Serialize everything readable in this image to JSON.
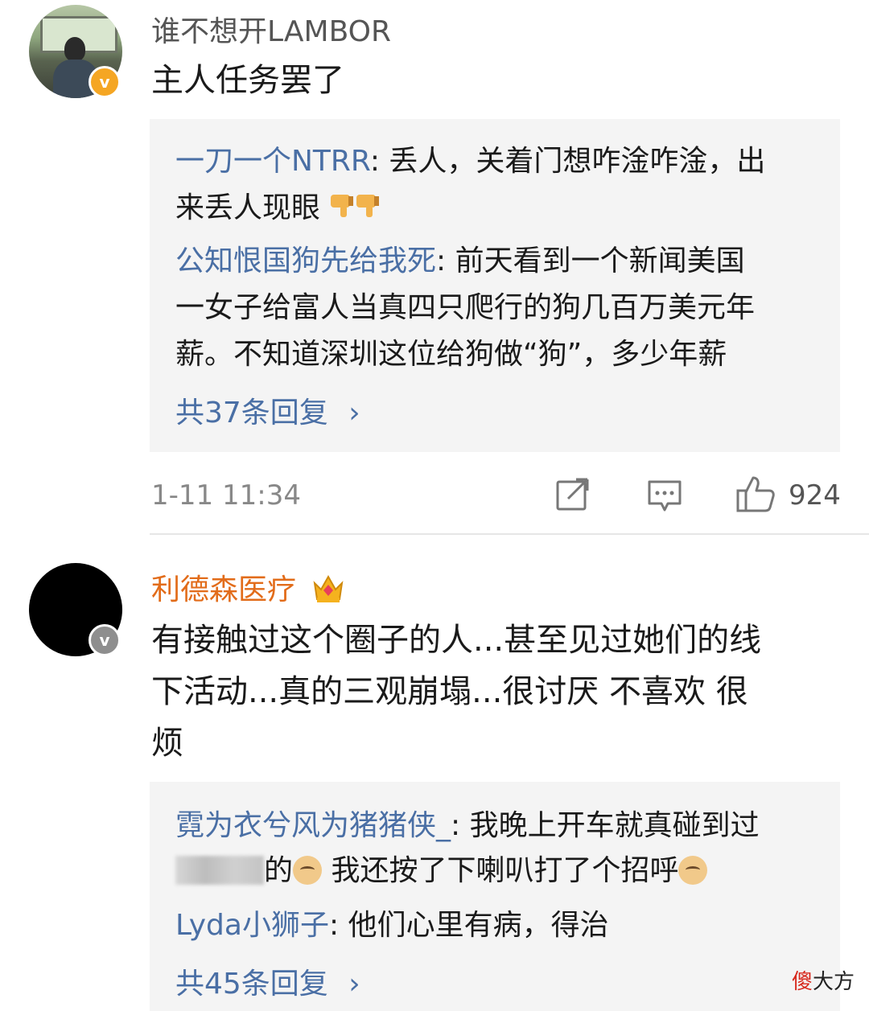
{
  "comment1": {
    "username": "谁不想开LAMBOR",
    "text": "主人任务罢了",
    "badge": "v",
    "replies": [
      {
        "name": "一刀一个NTRR",
        "sep": ": ",
        "text_line1": "丢人，关着门想咋淦咋淦，出",
        "text_line2": "来丢人现眼",
        "emoji": "thumbs-down-icon"
      },
      {
        "name": "公知恨国狗先给我死",
        "sep": ": ",
        "text_line1": "前天看到一个新闻美国",
        "text_line2": "一女子给富人当真四只爬行的狗几百万美元年",
        "text_line3": "薪。不知道深圳这位给狗做“狗”，多少年薪"
      }
    ],
    "more_replies": "共37条回复",
    "time": "1-11 11:34",
    "likes": "924"
  },
  "comment2": {
    "username": "利德森医疗",
    "badge": "v",
    "text_line1": "有接触过这个圈子的人...甚至见过她们的线",
    "text_line2": "下活动...真的三观崩塌...很讨厌 不喜欢 很",
    "text_line3": "烦",
    "replies": [
      {
        "name": "霓为衣兮风为猪猪侠_",
        "sep": ": ",
        "text_line1": "我晚上开车就真碰到过",
        "text_line2a": "的",
        "text_line2b": " 我还按了下喇叭打了个招呼"
      },
      {
        "name": "Lyda小狮子",
        "sep": ": ",
        "text_line1": "他们心里有病，得治"
      }
    ],
    "more_replies": "共45条回复"
  },
  "watermark": {
    "red": "傻",
    "black": "大方"
  },
  "colors": {
    "link": "#4a6fa5",
    "orange_name": "#e26c1a",
    "gold_badge": "#f5a623"
  }
}
